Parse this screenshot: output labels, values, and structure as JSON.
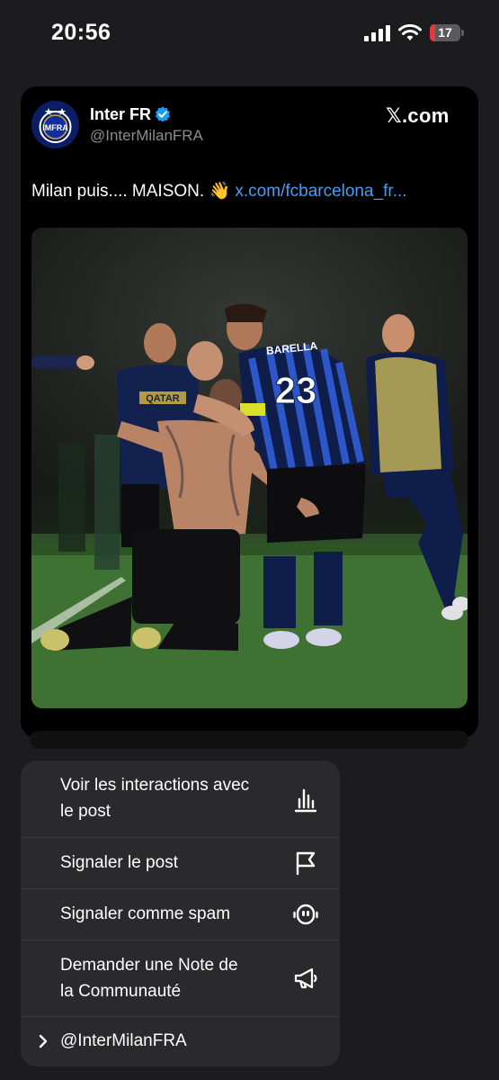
{
  "status_bar": {
    "time": "20:56",
    "battery_level": "17",
    "battery_color": "#e0393e"
  },
  "tweet": {
    "author_name": "Inter FR",
    "author_handle": "@InterMilanFRA",
    "verified_badge_color": "#1d9bf0",
    "source_logo": "𝕏.com",
    "text": "Milan puis.... MAISON. 👋 ",
    "link": "x.com/fcbarcelona_fr...",
    "avatar_text": "IMFRA",
    "media_description": "photo-inter-players-celebrating",
    "jersey_name": "BARELLA",
    "jersey_number": "23",
    "sponsor": "QATAR"
  },
  "menu": {
    "items": [
      {
        "label_line1": "Voir les interactions avec",
        "label_line2": "le post",
        "icon": "chart-icon"
      },
      {
        "label": "Signaler le post",
        "icon": "flag-icon"
      },
      {
        "label": "Signaler comme spam",
        "icon": "robot-icon"
      },
      {
        "label_line1": "Demander une Note de",
        "label_line2": "la Communauté",
        "icon": "megaphone-icon"
      },
      {
        "label": "@InterMilanFRA",
        "icon": "chevron-right-icon"
      }
    ]
  },
  "colors": {
    "link": "#4a9cf0",
    "menu_background": "#2a2a2c",
    "page_background": "#1c1c1e"
  }
}
